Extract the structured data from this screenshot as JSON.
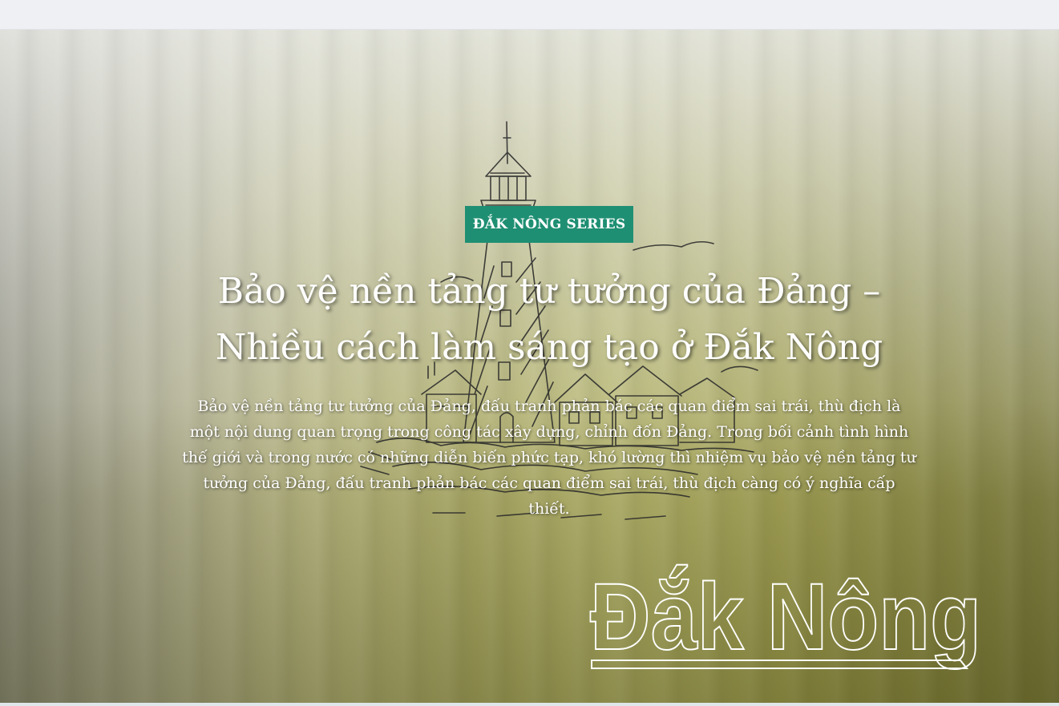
{
  "hero": {
    "badge_label": "ĐẮK NÔNG SERIES",
    "title_line1": "Bảo vệ nền tảng tư tưởng của Đảng –",
    "title_line2": "Nhiều cách làm sáng tạo ở Đắk Nông",
    "summary": "Bảo vệ nền tảng tư tưởng của Đảng, đấu tranh phản bác các quan điểm sai trái, thù địch là một nội dung quan trọng trong công tác xây dựng, chỉnh đốn Đảng. Trong bối cảnh tình hình thế giới và trong nước có những diễn biến phức tạp, khó lường thì nhiệm vụ bảo vệ nền tảng tư tưởng của Đảng, đấu tranh phản bác các quan điểm sai trái, thù địch càng có ý nghĩa cấp thiết.",
    "logo_text": "Đắk Nông",
    "illustration": "lighthouse-sketch"
  },
  "colors": {
    "badge_bg": "#1f8f73",
    "text": "#ffffff",
    "top_bar": "#eef0f4"
  }
}
